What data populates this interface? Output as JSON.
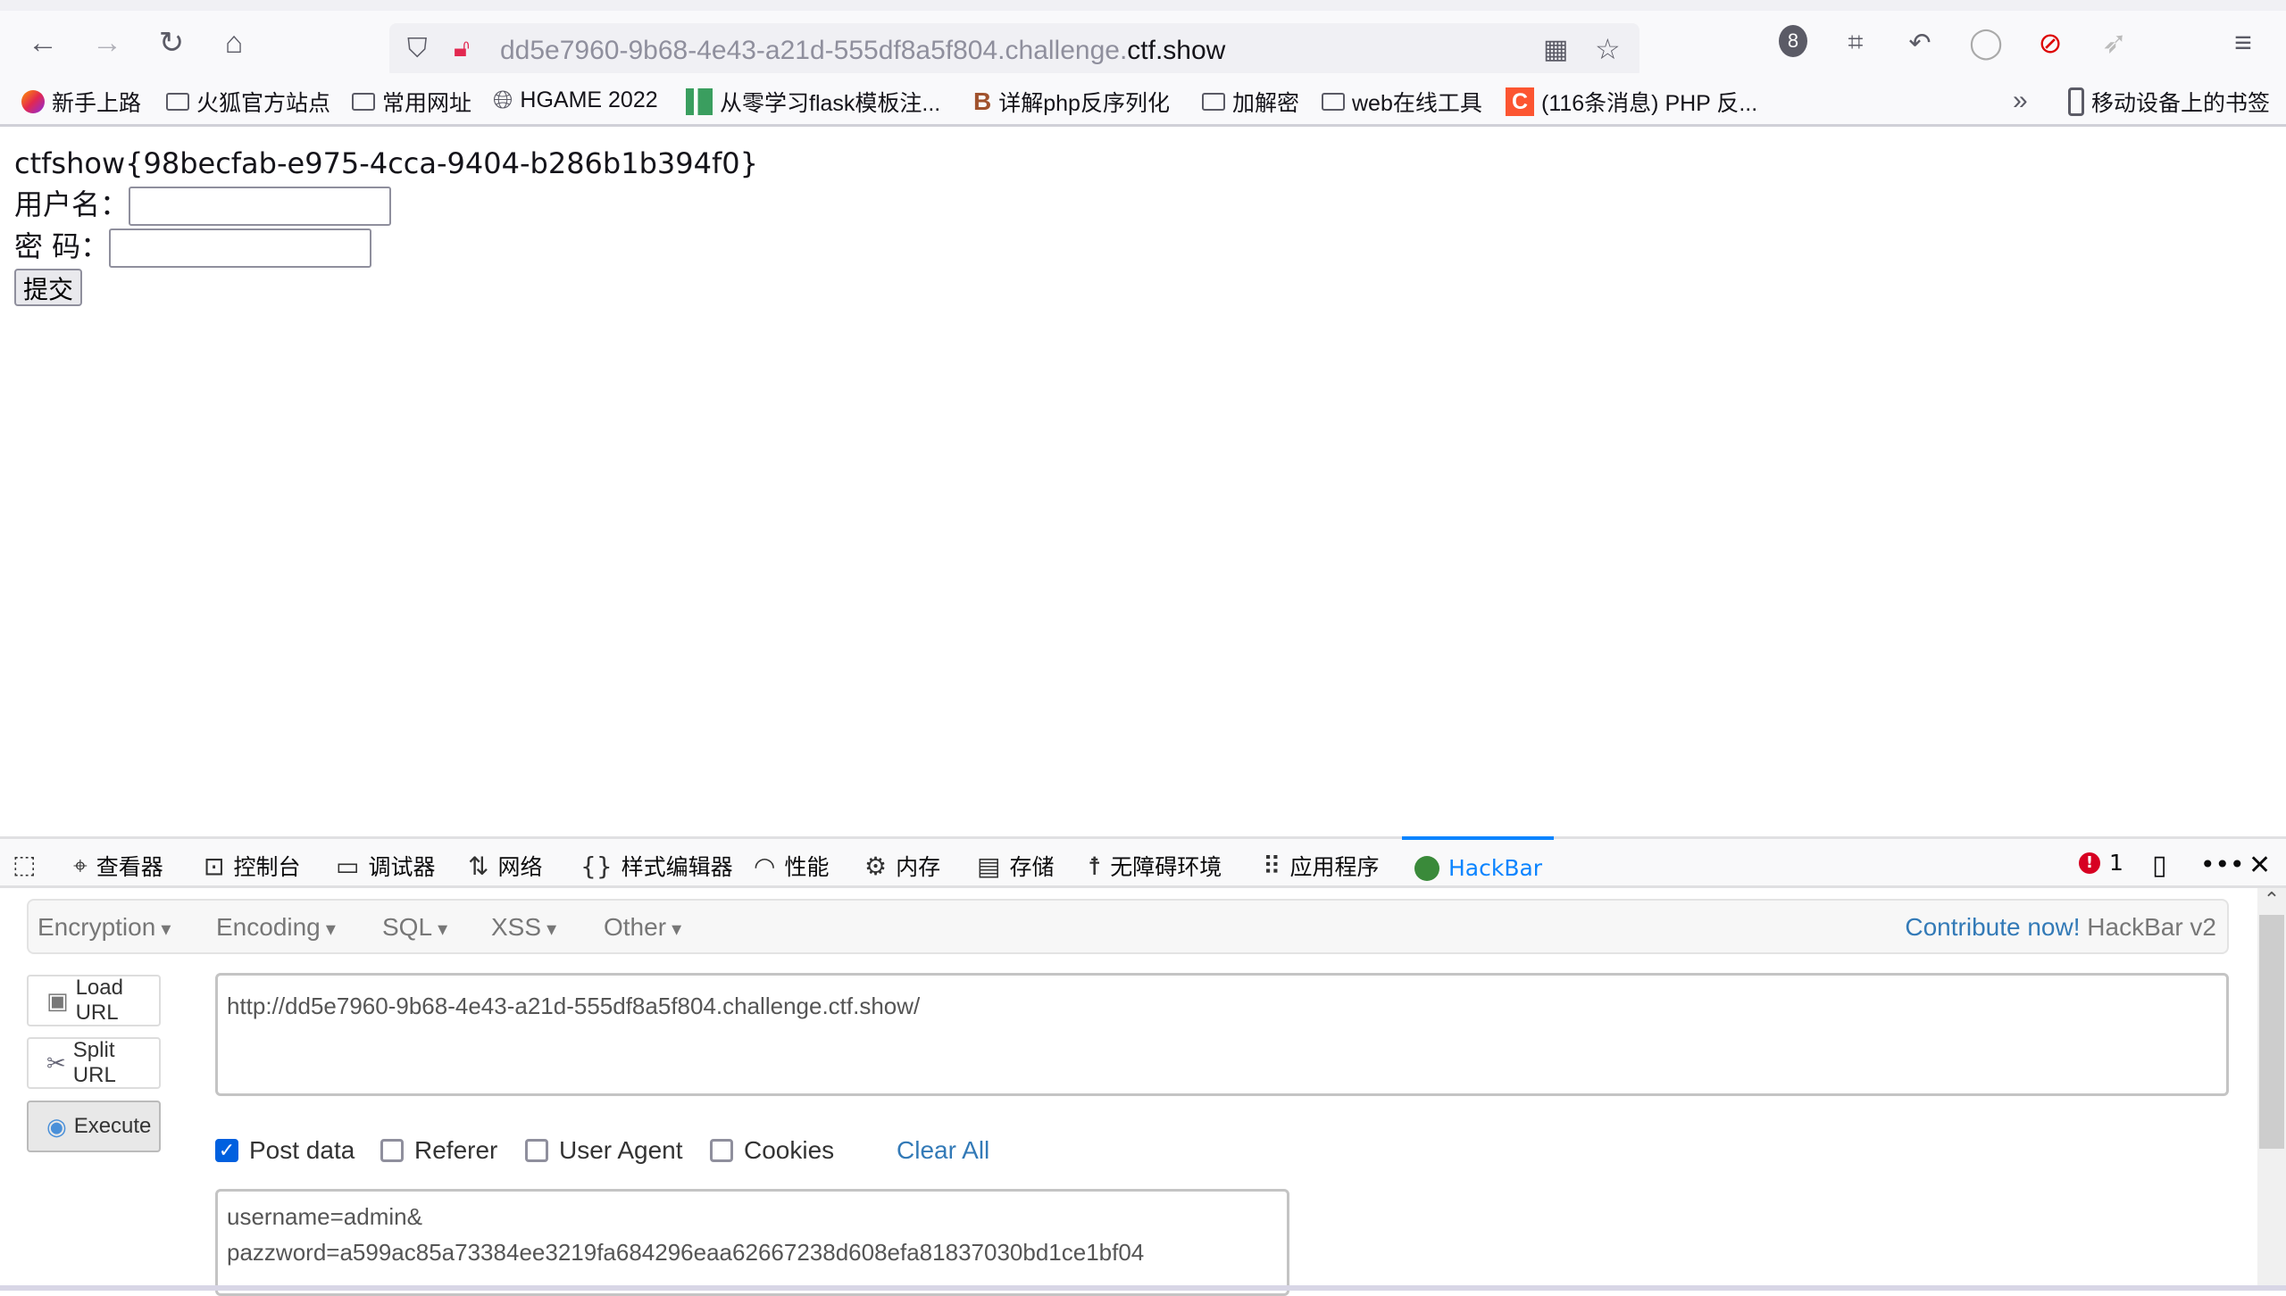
{
  "browser": {
    "url_prefix": "dd5e7960-9b68-4e43-a21d-555df8a5f804.challenge.",
    "url_domain": "ctf.show",
    "extension_badge": "8",
    "bookmarks": [
      {
        "label": "新手上路",
        "icon": "firefox-icon"
      },
      {
        "label": "火狐官方站点",
        "icon": "folder-icon"
      },
      {
        "label": "常用网址",
        "icon": "folder-icon"
      },
      {
        "label": "HGAME 2022",
        "icon": "globe-icon"
      },
      {
        "label": "从零学习flask模板注...",
        "icon": "site-icon"
      },
      {
        "label": "详解php反序列化",
        "icon": "site-icon"
      },
      {
        "label": "加解密",
        "icon": "folder-icon"
      },
      {
        "label": "web在线工具",
        "icon": "folder-icon"
      },
      {
        "label": "(116条消息) PHP 反...",
        "icon": "csdn-icon"
      }
    ],
    "mobile_bookmarks": "移动设备上的书签"
  },
  "page": {
    "flag": "ctfshow{98becfab-e975-4cca-9404-b286b1b394f0}",
    "username_label": "用户名：",
    "password_label": "密 码：",
    "submit_label": "提交"
  },
  "devtools": {
    "tabs": [
      {
        "label": "查看器",
        "icon": "inspector-icon"
      },
      {
        "label": "控制台",
        "icon": "console-icon"
      },
      {
        "label": "调试器",
        "icon": "debugger-icon"
      },
      {
        "label": "网络",
        "icon": "network-icon"
      },
      {
        "label": "样式编辑器",
        "icon": "style-editor-icon"
      },
      {
        "label": "性能",
        "icon": "performance-icon"
      },
      {
        "label": "内存",
        "icon": "memory-icon"
      },
      {
        "label": "存储",
        "icon": "storage-icon"
      },
      {
        "label": "无障碍环境",
        "icon": "accessibility-icon"
      },
      {
        "label": "应用程序",
        "icon": "application-icon"
      }
    ],
    "active_tab": "HackBar",
    "error_count": "1",
    "accent": "#0a84ff"
  },
  "hackbar": {
    "menus": [
      "Encryption",
      "Encoding",
      "SQL",
      "XSS",
      "Other"
    ],
    "contribute": "Contribute now!",
    "version": "HackBar v2",
    "load_url": "Load URL",
    "split_url": "Split URL",
    "execute": "Execute",
    "url_value": "http://dd5e7960-9b68-4e43-a21d-555df8a5f804.challenge.ctf.show/",
    "options": [
      {
        "label": "Post data",
        "checked": true
      },
      {
        "label": "Referer",
        "checked": false
      },
      {
        "label": "User Agent",
        "checked": false
      },
      {
        "label": "Cookies",
        "checked": false
      }
    ],
    "clear_all": "Clear All",
    "post_line1": "username=admin&",
    "post_line2": "pazzword=a599ac85a73384ee3219fa684296eaa62667238d608efa81837030bd1ce1bf04"
  }
}
